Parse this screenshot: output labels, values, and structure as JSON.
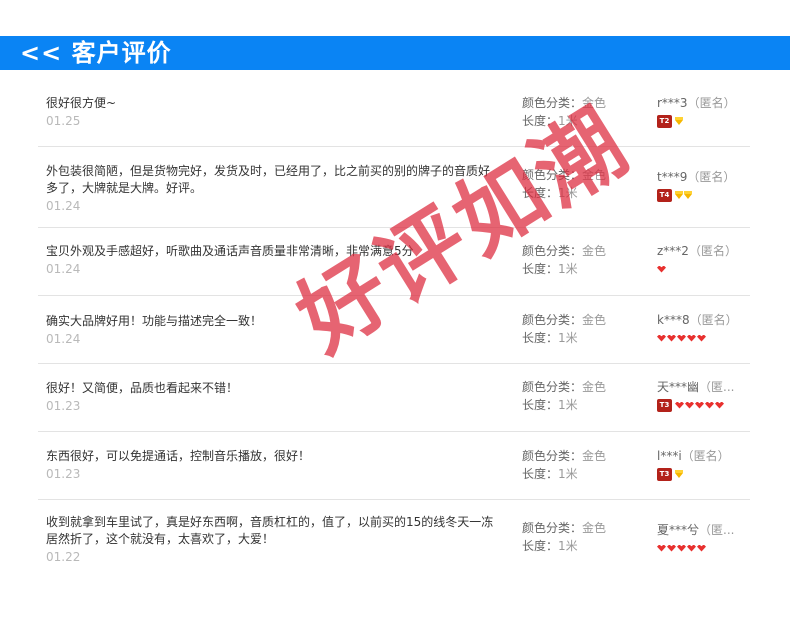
{
  "header": {
    "title": "<< 客户评价"
  },
  "sku_labels": {
    "color": "颜色分类：",
    "length": "长度："
  },
  "reviews": [
    {
      "content": "很好很方便~",
      "date": "01.25",
      "color": "金色",
      "length": "1米",
      "user": "r***3",
      "anon": "（匿名）",
      "level": "T2",
      "diamonds": 1,
      "hearts": 0
    },
    {
      "content": "外包装很简陋，但是货物完好，发货及时，已经用了，比之前买的别的牌子的音质好多了，大牌就是大牌。好评。",
      "date": "01.24",
      "color": "金色",
      "length": "1米",
      "user": "t***9",
      "anon": "（匿名）",
      "level": "T4",
      "diamonds": 2,
      "hearts": 0
    },
    {
      "content": "宝贝外观及手感超好，听歌曲及通话声音质量非常清晰，非常满意5分",
      "date": "01.24",
      "color": "金色",
      "length": "1米",
      "user": "z***2",
      "anon": "（匿名）",
      "level": "",
      "diamonds": 0,
      "hearts": 1
    },
    {
      "content": "确实大品牌好用！功能与描述完全一致！",
      "date": "01.24",
      "color": "金色",
      "length": "1米",
      "user": "k***8",
      "anon": "（匿名）",
      "level": "",
      "diamonds": 0,
      "hearts": 5
    },
    {
      "content": "很好！又简便，品质也看起来不错！",
      "date": "01.23",
      "color": "金色",
      "length": "1米",
      "user": "天***幽",
      "anon": "（匿...",
      "level": "T3",
      "diamonds": 0,
      "hearts": 5
    },
    {
      "content": "东西很好，可以免提通话，控制音乐播放，很好！",
      "date": "01.23",
      "color": "金色",
      "length": "1米",
      "user": "l***i",
      "anon": "（匿名）",
      "level": "T3",
      "diamonds": 1,
      "hearts": 0
    },
    {
      "content": "收到就拿到车里试了，真是好东西啊，音质杠杠的，值了，以前买的15的线冬天一冻居然折了，这个就没有，太喜欢了，大爱！",
      "date": "01.22",
      "color": "金色",
      "length": "1米",
      "user": "夏***兮",
      "anon": "（匿...",
      "level": "",
      "diamonds": 0,
      "hearts": 5
    }
  ],
  "watermark": "好评如潮",
  "colors": {
    "header_bg": "#0a84f4",
    "watermark": "#dd283c",
    "date": "#b9b9b9"
  }
}
